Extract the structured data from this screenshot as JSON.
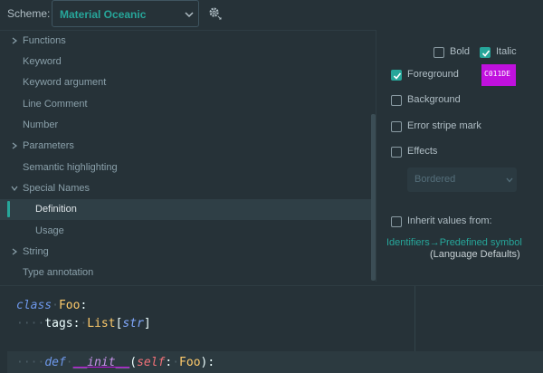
{
  "scheme": {
    "label": "Scheme:",
    "value": "Material Oceanic"
  },
  "tree": {
    "items": [
      {
        "label": "Functions",
        "expandable": true,
        "expanded": false,
        "indent": 0
      },
      {
        "label": "Keyword",
        "expandable": false,
        "indent": 0
      },
      {
        "label": "Keyword argument",
        "expandable": false,
        "indent": 0
      },
      {
        "label": "Line Comment",
        "expandable": false,
        "indent": 0
      },
      {
        "label": "Number",
        "expandable": false,
        "indent": 0
      },
      {
        "label": "Parameters",
        "expandable": true,
        "expanded": false,
        "indent": 0
      },
      {
        "label": "Semantic highlighting",
        "expandable": false,
        "indent": 0
      },
      {
        "label": "Special Names",
        "expandable": true,
        "expanded": true,
        "indent": 0
      },
      {
        "label": "Definition",
        "expandable": false,
        "indent": 1,
        "selected": true
      },
      {
        "label": "Usage",
        "expandable": false,
        "indent": 1
      },
      {
        "label": "String",
        "expandable": true,
        "expanded": false,
        "indent": 0
      },
      {
        "label": "Type annotation",
        "expandable": false,
        "indent": 0
      }
    ]
  },
  "options": {
    "bold": {
      "label": "Bold",
      "checked": false
    },
    "italic": {
      "label": "Italic",
      "checked": true
    },
    "foreground": {
      "label": "Foreground",
      "checked": true,
      "color_text": "C011DE",
      "color": "#C011DE"
    },
    "background": {
      "label": "Background",
      "checked": false
    },
    "error_stripe": {
      "label": "Error stripe mark",
      "checked": false
    },
    "effects": {
      "label": "Effects",
      "checked": false,
      "select_value": "Bordered"
    },
    "inherit": {
      "label": "Inherit values from:",
      "checked": false
    }
  },
  "inherit_link": "Identifiers→Predefined symbol",
  "inherit_source": "(Language Defaults)",
  "colors": {
    "accent": "#26A69A",
    "background": "#263238"
  },
  "preview": {
    "line1": {
      "kw": "class",
      "ws": "·",
      "name": "Foo",
      "punct": ":"
    },
    "line2": {
      "ws": "····",
      "attr": "tags",
      "punct": ":",
      "ws2": "·",
      "type": "List",
      "bracket_open": "[",
      "inner": "str",
      "bracket_close": "]"
    },
    "line4": {
      "ws": "····",
      "kw": "def",
      "ws2": "·",
      "name": "__init__",
      "open": "(",
      "self": "self",
      "colon": ":",
      "ws3": "·",
      "type": "Foo",
      "close": "):"
    }
  }
}
